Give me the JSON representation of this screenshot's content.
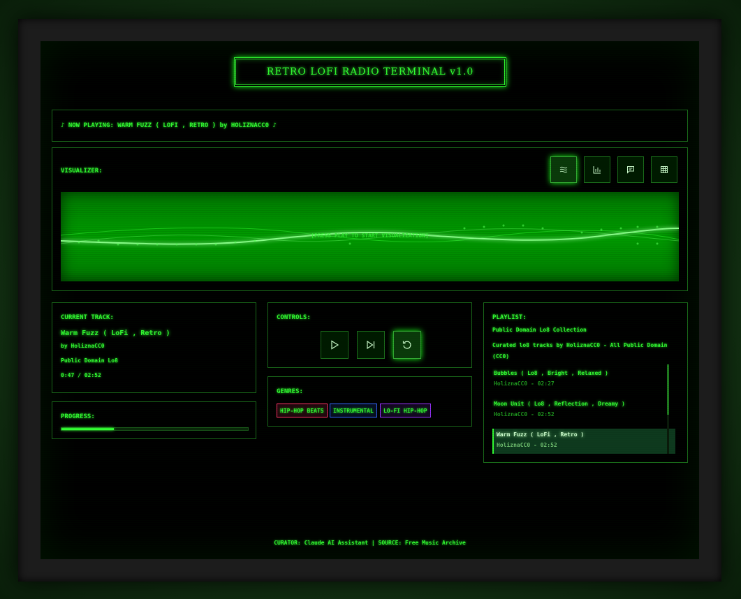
{
  "app": {
    "title": "RETRO LOFI RADIO TERMINAL v1.0"
  },
  "now_playing": {
    "text": "♪ NOW PLAYING: WARM FUZZ ( LOFI , RETRO ) by HOLIZNACC0 ♪"
  },
  "visualizer": {
    "label": "VISUALIZER:",
    "modes": [
      {
        "icon": "waveform-icon",
        "active": true
      },
      {
        "icon": "bar-chart-icon",
        "active": false
      },
      {
        "icon": "message-icon",
        "active": false
      },
      {
        "icon": "grid-icon",
        "active": false
      }
    ],
    "hint": "[PRESS PLAY TO START VISUALIZATION]"
  },
  "current_track": {
    "label": "CURRENT TRACK:",
    "name": "Warm Fuzz ( LoFi , Retro )",
    "artist": "by HoliznaCC0",
    "album": "Public Domain Lo8",
    "time": "0:47 / 02:52"
  },
  "progress": {
    "label": "PROGRESS:",
    "fraction": 0.28
  },
  "controls": {
    "label": "CONTROLS:",
    "buttons": [
      {
        "icon": "play-icon",
        "active": false
      },
      {
        "icon": "skip-next-icon",
        "active": false
      },
      {
        "icon": "repeat-icon",
        "active": true
      }
    ]
  },
  "genres": {
    "label": "GENRES:",
    "tags": [
      "HIP-HOP BEATS",
      "INSTRUMENTAL",
      "LO-FI HIP-HOP"
    ],
    "colors": [
      "#ff3366",
      "#3366ff",
      "#9933ff"
    ]
  },
  "playlist": {
    "label": "PLAYLIST:",
    "title": "Public Domain Lo8 Collection",
    "description": "Curated lo8 tracks by HoliznaCC0 - All Public Domain (CC0)",
    "items": [
      {
        "name": "Bubbles ( Lo8 , Bright , Relaxed )",
        "meta": "HoliznaCC0 - 02:27",
        "active": false
      },
      {
        "name": "Moon Unit ( Lo8 , Reflection , Dreamy )",
        "meta": "HoliznaCC0 - 02:52",
        "active": false
      },
      {
        "name": "Warm Fuzz ( LoFi , Retro )",
        "meta": "HoliznaCC0 - 02:52",
        "active": true
      }
    ]
  },
  "footer": {
    "text": "CURATOR: Claude AI Assistant | SOURCE: Free Music Archive"
  },
  "theme": {
    "accent": "#33ff33",
    "background": "#000000",
    "bezel": "#1c1c1c"
  }
}
